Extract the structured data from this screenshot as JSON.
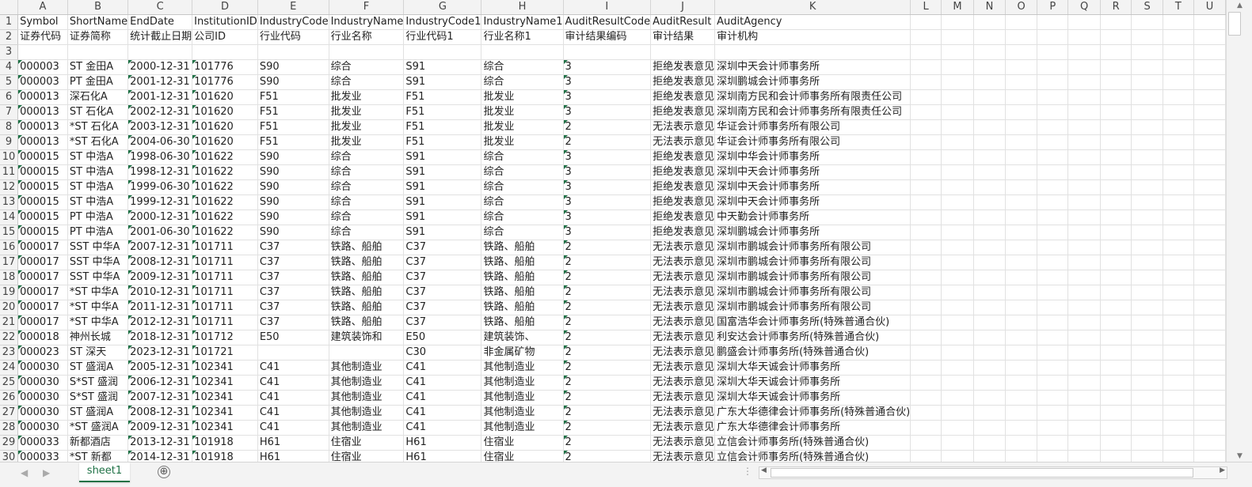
{
  "columns": [
    "A",
    "B",
    "C",
    "D",
    "E",
    "F",
    "G",
    "H",
    "I",
    "J",
    "K",
    "L",
    "M",
    "N",
    "O",
    "P",
    "Q",
    "R",
    "S",
    "T",
    "U"
  ],
  "header_row": [
    "Symbol",
    "ShortName",
    "EndDate",
    "InstitutionID",
    "IndustryCode",
    "IndustryName",
    "IndustryCode1",
    "IndustryName1",
    "AuditResultCode",
    "AuditResult",
    "AuditAgency"
  ],
  "label_row": [
    "证券代码",
    "证券简称",
    "统计截止日期",
    "公司ID",
    "行业代码",
    "行业名称",
    "行业代码1",
    "行业名称1",
    "审计结果编码",
    "审计结果",
    "审计机构"
  ],
  "rows": [
    [
      "000003",
      "ST 金田A",
      "2000-12-31",
      "101776",
      "S90",
      "综合",
      "S91",
      "综合",
      "3",
      "拒绝发表意见",
      "深圳中天会计师事务所"
    ],
    [
      "000003",
      "PT 金田A",
      "2001-12-31",
      "101776",
      "S90",
      "综合",
      "S91",
      "综合",
      "3",
      "拒绝发表意见",
      "深圳鹏城会计师事务所"
    ],
    [
      "000013",
      "深石化A",
      "2001-12-31",
      "101620",
      "F51",
      "批发业",
      "F51",
      "批发业",
      "3",
      "拒绝发表意见",
      "深圳南方民和会计师事务所有限责任公司"
    ],
    [
      "000013",
      "ST 石化A",
      "2002-12-31",
      "101620",
      "F51",
      "批发业",
      "F51",
      "批发业",
      "3",
      "拒绝发表意见",
      "深圳南方民和会计师事务所有限责任公司"
    ],
    [
      "000013",
      "*ST 石化A",
      "2003-12-31",
      "101620",
      "F51",
      "批发业",
      "F51",
      "批发业",
      "2",
      "无法表示意见",
      "华证会计师事务所有限公司"
    ],
    [
      "000013",
      "*ST 石化A",
      "2004-06-30",
      "101620",
      "F51",
      "批发业",
      "F51",
      "批发业",
      "2",
      "无法表示意见",
      "华证会计师事务所有限公司"
    ],
    [
      "000015",
      "ST 中浩A",
      "1998-06-30",
      "101622",
      "S90",
      "综合",
      "S91",
      "综合",
      "3",
      "拒绝发表意见",
      "深圳中华会计师事务所"
    ],
    [
      "000015",
      "ST 中浩A",
      "1998-12-31",
      "101622",
      "S90",
      "综合",
      "S91",
      "综合",
      "3",
      "拒绝发表意见",
      "深圳中天会计师事务所"
    ],
    [
      "000015",
      "ST 中浩A",
      "1999-06-30",
      "101622",
      "S90",
      "综合",
      "S91",
      "综合",
      "3",
      "拒绝发表意见",
      "深圳中天会计师事务所"
    ],
    [
      "000015",
      "ST 中浩A",
      "1999-12-31",
      "101622",
      "S90",
      "综合",
      "S91",
      "综合",
      "3",
      "拒绝发表意见",
      "深圳中天会计师事务所"
    ],
    [
      "000015",
      "PT 中浩A",
      "2000-12-31",
      "101622",
      "S90",
      "综合",
      "S91",
      "综合",
      "3",
      "拒绝发表意见",
      "中天勤会计师事务所"
    ],
    [
      "000015",
      "PT 中浩A",
      "2001-06-30",
      "101622",
      "S90",
      "综合",
      "S91",
      "综合",
      "3",
      "拒绝发表意见",
      "深圳鹏城会计师事务所"
    ],
    [
      "000017",
      "SST 中华A",
      "2007-12-31",
      "101711",
      "C37",
      "铁路、船舶",
      "C37",
      "铁路、船舶",
      "2",
      "无法表示意见",
      "深圳市鹏城会计师事务所有限公司"
    ],
    [
      "000017",
      "SST 中华A",
      "2008-12-31",
      "101711",
      "C37",
      "铁路、船舶",
      "C37",
      "铁路、船舶",
      "2",
      "无法表示意见",
      "深圳市鹏城会计师事务所有限公司"
    ],
    [
      "000017",
      "SST 中华A",
      "2009-12-31",
      "101711",
      "C37",
      "铁路、船舶",
      "C37",
      "铁路、船舶",
      "2",
      "无法表示意见",
      "深圳市鹏城会计师事务所有限公司"
    ],
    [
      "000017",
      "*ST 中华A",
      "2010-12-31",
      "101711",
      "C37",
      "铁路、船舶",
      "C37",
      "铁路、船舶",
      "2",
      "无法表示意见",
      "深圳市鹏城会计师事务所有限公司"
    ],
    [
      "000017",
      "*ST 中华A",
      "2011-12-31",
      "101711",
      "C37",
      "铁路、船舶",
      "C37",
      "铁路、船舶",
      "2",
      "无法表示意见",
      "深圳市鹏城会计师事务所有限公司"
    ],
    [
      "000017",
      "*ST 中华A",
      "2012-12-31",
      "101711",
      "C37",
      "铁路、船舶",
      "C37",
      "铁路、船舶",
      "2",
      "无法表示意见",
      "国富浩华会计师事务所(特殊普通合伙)"
    ],
    [
      "000018",
      "神州长城",
      "2018-12-31",
      "101712",
      "E50",
      "建筑装饰和",
      "E50",
      "建筑装饰、",
      "2",
      "无法表示意见",
      "利安达会计师事务所(特殊普通合伙)"
    ],
    [
      "000023",
      "ST 深天",
      "2023-12-31",
      "101721",
      "",
      "",
      "C30",
      "非金属矿物",
      "2",
      "无法表示意见",
      "鹏盛会计师事务所(特殊普通合伙)"
    ],
    [
      "000030",
      "ST 盛润A",
      "2005-12-31",
      "102341",
      "C41",
      "其他制造业",
      "C41",
      "其他制造业",
      "2",
      "无法表示意见",
      "深圳大华天诚会计师事务所"
    ],
    [
      "000030",
      "S*ST 盛润",
      "2006-12-31",
      "102341",
      "C41",
      "其他制造业",
      "C41",
      "其他制造业",
      "2",
      "无法表示意见",
      "深圳大华天诚会计师事务所"
    ],
    [
      "000030",
      "S*ST 盛润",
      "2007-12-31",
      "102341",
      "C41",
      "其他制造业",
      "C41",
      "其他制造业",
      "2",
      "无法表示意见",
      "深圳大华天诚会计师事务所"
    ],
    [
      "000030",
      "ST 盛润A",
      "2008-12-31",
      "102341",
      "C41",
      "其他制造业",
      "C41",
      "其他制造业",
      "2",
      "无法表示意见",
      "广东大华德律会计师事务所(特殊普通合伙)"
    ],
    [
      "000030",
      "*ST 盛润A",
      "2009-12-31",
      "102341",
      "C41",
      "其他制造业",
      "C41",
      "其他制造业",
      "2",
      "无法表示意见",
      "广东大华德律会计师事务所"
    ],
    [
      "000033",
      "新都酒店",
      "2013-12-31",
      "101918",
      "H61",
      "住宿业",
      "H61",
      "住宿业",
      "2",
      "无法表示意见",
      "立信会计师事务所(特殊普通合伙)"
    ],
    [
      "000033",
      "*ST 新都",
      "2014-12-31",
      "101918",
      "H61",
      "住宿业",
      "H61",
      "住宿业",
      "2",
      "无法表示意见",
      "立信会计师事务所(特殊普通合伙)"
    ]
  ],
  "sheet_tab": "sheet1",
  "add_sheet_symbol": "⊕",
  "first_row_number": 1
}
